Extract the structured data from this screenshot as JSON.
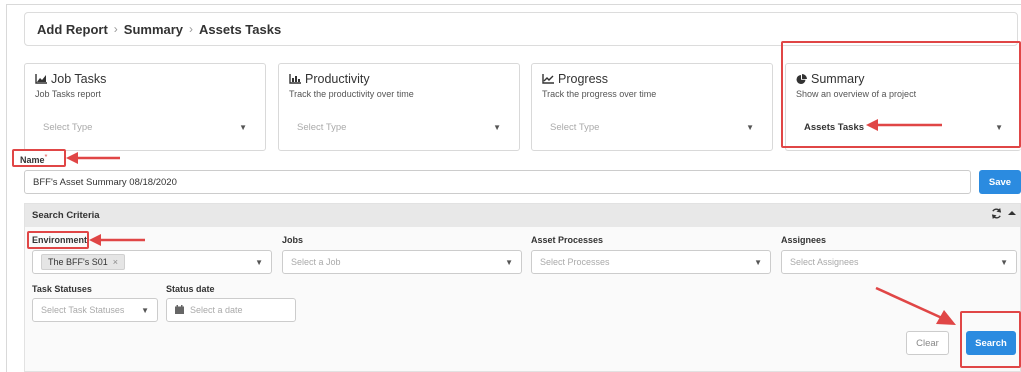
{
  "breadcrumb": {
    "item1": "Add Report",
    "item2": "Summary",
    "item3": "Assets Tasks",
    "separator": "›"
  },
  "cards": [
    {
      "title": "Job Tasks",
      "subtitle": "Job Tasks report",
      "select_value": "Select Type",
      "icon": "area-chart-icon"
    },
    {
      "title": "Productivity",
      "subtitle": "Track the productivity over time",
      "select_value": "Select Type",
      "icon": "bar-chart-icon"
    },
    {
      "title": "Progress",
      "subtitle": "Track the progress over time",
      "select_value": "Select Type",
      "icon": "line-chart-icon"
    },
    {
      "title": "Summary",
      "subtitle": "Show an overview of a project",
      "select_value": "Assets Tasks",
      "icon": "pie-chart-icon"
    }
  ],
  "name_field": {
    "label": "Name",
    "required_mark": "*",
    "value": "BFF's Asset Summary 08/18/2020"
  },
  "save_label": "Save",
  "search_criteria": {
    "title": "Search Criteria",
    "environment": {
      "label": "Environment",
      "tag": "The BFF's S01",
      "tag_remove": "×"
    },
    "jobs": {
      "label": "Jobs",
      "placeholder": "Select a Job"
    },
    "asset_processes": {
      "label": "Asset Processes",
      "placeholder": "Select Processes"
    },
    "assignees": {
      "label": "Assignees",
      "placeholder": "Select Assignees"
    },
    "task_statuses": {
      "label": "Task Statuses",
      "placeholder": "Select Task Statuses"
    },
    "status_date": {
      "label": "Status date",
      "placeholder": "Select a date"
    }
  },
  "clear_label": "Clear",
  "search_label": "Search",
  "colors": {
    "primary": "#2b8be0",
    "annotation": "#e04646"
  }
}
